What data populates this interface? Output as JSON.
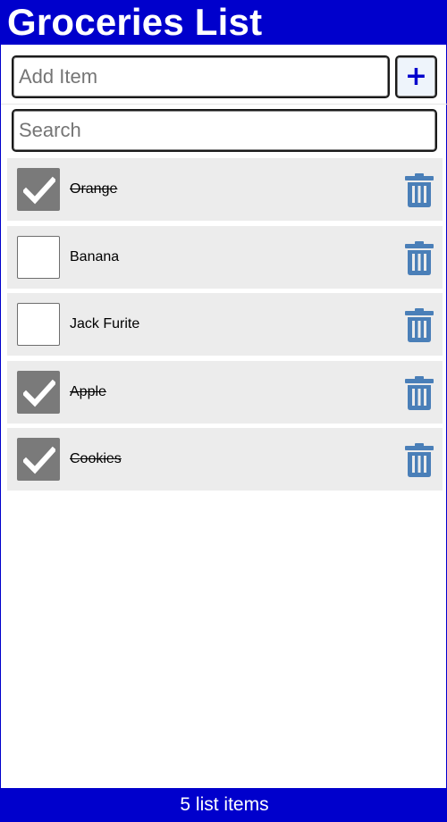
{
  "header": {
    "title": "Groceries List"
  },
  "add_form": {
    "placeholder": "Add Item",
    "value": "",
    "button_label": "+"
  },
  "search": {
    "placeholder": "Search",
    "value": ""
  },
  "items": [
    {
      "label": "Orange",
      "checked": true
    },
    {
      "label": "Banana",
      "checked": false
    },
    {
      "label": "Jack Furite",
      "checked": false
    },
    {
      "label": "Apple",
      "checked": true
    },
    {
      "label": "Cookies",
      "checked": true
    }
  ],
  "footer": {
    "text": "5 list items"
  },
  "colors": {
    "brand": "#0000cc",
    "checked_box": "#7a7a7a",
    "trash_icon": "#4a7fb8",
    "row_background": "#ececec"
  },
  "icons": {
    "check": "check-icon",
    "delete": "trash-icon",
    "add": "plus-icon"
  }
}
